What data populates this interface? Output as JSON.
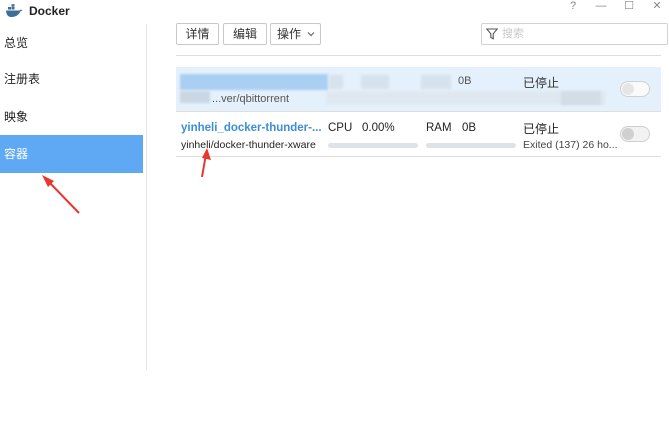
{
  "window": {
    "title": "Docker",
    "controls": [
      "?",
      "—",
      "☐",
      "✕"
    ]
  },
  "sidebar": {
    "items": [
      {
        "label": "总览"
      },
      {
        "label": "注册表"
      },
      {
        "label": "映象"
      },
      {
        "label": "容器",
        "active": true
      }
    ]
  },
  "toolbar": {
    "details_label": "详情",
    "edit_label": "编辑",
    "actions_label": "操作",
    "search_placeholder": "搜索"
  },
  "containers": [
    {
      "name": "",
      "image": "...ver/qbittorrent",
      "ram_value": "0B",
      "status": "已停止",
      "running": false
    },
    {
      "name": "yinheli_docker-thunder-...",
      "image": "yinheli/docker-thunder-xware",
      "cpu_label": "CPU",
      "cpu_value": "0.00%",
      "cpu_usage": 0,
      "ram_label": "RAM",
      "ram_value": "0B",
      "ram_usage": 0,
      "status": "已停止",
      "status_detail": "Exited (137) 26 ho...",
      "running": false
    }
  ],
  "colors": {
    "accent": "#5fa9f4",
    "link": "#3b8fd9",
    "annotation": "#e8372c"
  }
}
